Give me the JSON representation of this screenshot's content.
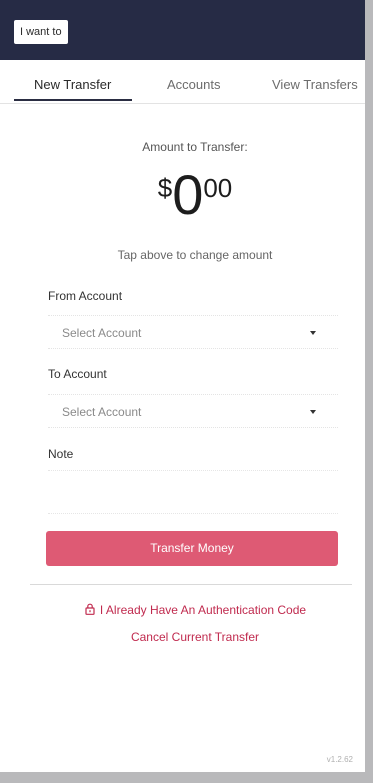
{
  "header": {
    "want_button": "I want to"
  },
  "tabs": [
    {
      "label": "New Transfer",
      "active": true
    },
    {
      "label": "Accounts",
      "active": false
    },
    {
      "label": "View Transfers",
      "active": false
    }
  ],
  "amount": {
    "label": "Amount to Transfer:",
    "currency": "$",
    "whole": "0",
    "cents": "00",
    "hint": "Tap above to change amount"
  },
  "form": {
    "from_label": "From Account",
    "from_placeholder": "Select Account",
    "to_label": "To Account",
    "to_placeholder": "Select Account",
    "note_label": "Note",
    "submit_label": "Transfer Money"
  },
  "links": {
    "auth_code": "I Already Have An Authentication Code",
    "cancel": "Cancel Current Transfer"
  },
  "icons": {
    "lock": "lock-icon",
    "caret": "chevron-down-icon"
  },
  "colors": {
    "header_bg": "#262b45",
    "primary_button": "#de5a74",
    "link": "#c02a4e"
  },
  "version": "v1.2.62"
}
